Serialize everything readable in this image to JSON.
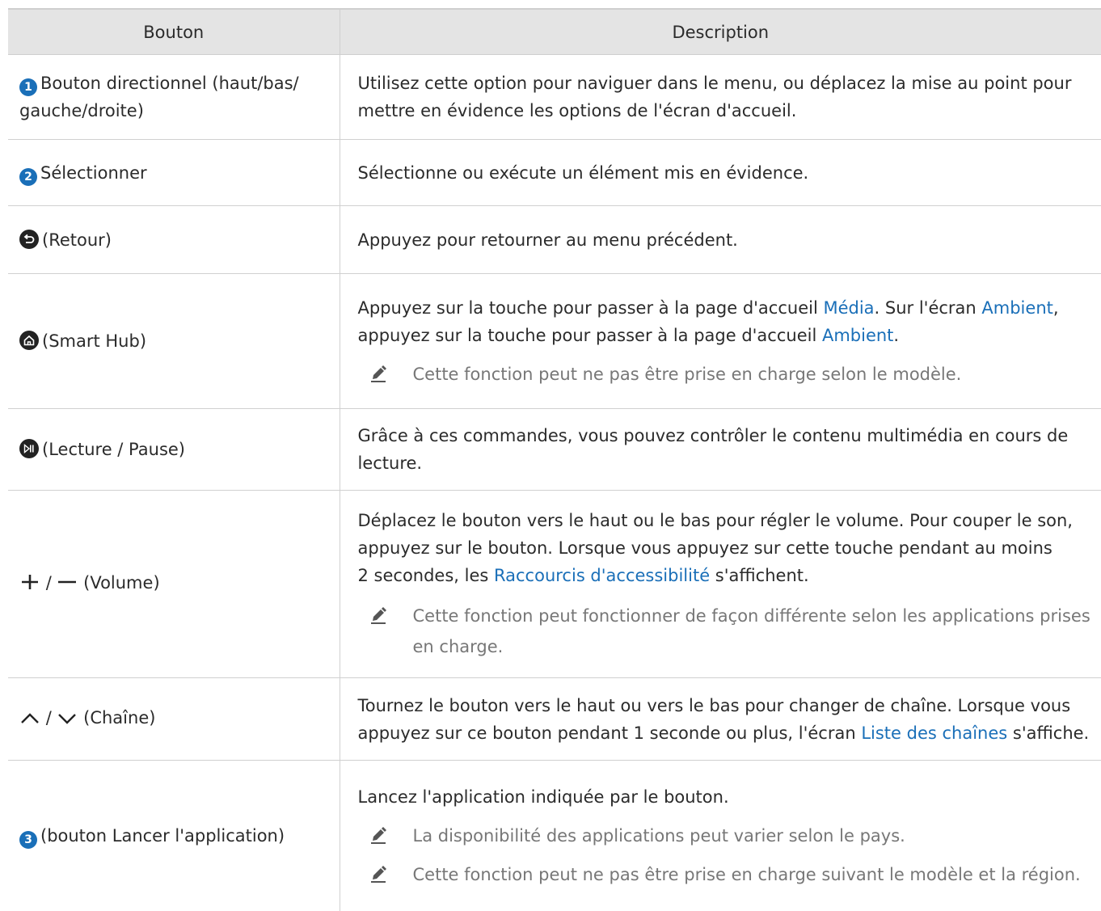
{
  "header": {
    "col_button": "Bouton",
    "col_description": "Description"
  },
  "rows": [
    {
      "button": {
        "icon_text": "1",
        "label": "Bouton directionnel (haut/bas/\ngauche/droite)"
      },
      "desc": "Utilisez cette option pour naviguer dans le menu, ou déplacez la mise au point pour\nmettre en évidence les options de l'écran d'accueil."
    },
    {
      "button": {
        "icon_text": "2",
        "label": "Sélectionner"
      },
      "desc": "Sélectionne ou exécute un élément mis en évidence."
    },
    {
      "button": {
        "icon": "return-icon",
        "label": "(Retour)"
      },
      "desc": "Appuyez pour retourner au menu précédent."
    },
    {
      "button": {
        "icon": "home-icon",
        "label": "(Smart Hub)"
      },
      "desc_parts": [
        "Appuyez sur la touche pour passer à la page d'accueil ",
        "Média",
        ". Sur l'écran ",
        "Ambient",
        ",",
        "appuyez sur la touche pour passer à la page d'accueil ",
        "Ambient",
        "."
      ],
      "note": "Cette fonction peut ne pas être prise en charge selon le modèle."
    },
    {
      "button": {
        "icon": "play-pause-icon",
        "label": "(Lecture / Pause)"
      },
      "desc": "Grâce à ces commandes, vous pouvez contrôler le contenu multimédia en cours de\nlecture."
    },
    {
      "button": {
        "icon": "plus-minus-icon",
        "slash": "/",
        "label": "(Volume)"
      },
      "desc_parts": [
        "Déplacez le bouton vers le haut ou le bas pour régler le volume. Pour couper le son,",
        "appuyez sur le bouton. Lorsque vous appuyez sur cette touche pendant au moins",
        "2 secondes, les ",
        "Raccourcis d'accessibilité",
        " s'affichent."
      ],
      "note": "Cette fonction peut fonctionner de façon différente selon les applications prises\nen charge."
    },
    {
      "button": {
        "icon": "up-down-chevron-icon",
        "slash": "/",
        "label": "(Chaîne)"
      },
      "desc_parts": [
        "Tournez le bouton vers le haut ou vers le bas pour changer de chaîne. Lorsque vous",
        "appuyez sur ce bouton pendant 1 seconde ou plus, l'écran ",
        "Liste des chaînes",
        " s'affiche."
      ]
    },
    {
      "button": {
        "icon_text": "3",
        "label": "(bouton Lancer l'application)"
      },
      "desc": "Lancez l'application indiquée par le bouton.",
      "notes": [
        "La disponibilité des applications peut varier selon le pays.",
        "Cette fonction peut ne pas être prise en charge suivant le modèle et la région."
      ]
    }
  ],
  "colors": {
    "link": "#1a6fb8",
    "header_bg": "#e4e4e4",
    "note_text": "#777777",
    "number_icon_bg": "#1a6fb8"
  }
}
